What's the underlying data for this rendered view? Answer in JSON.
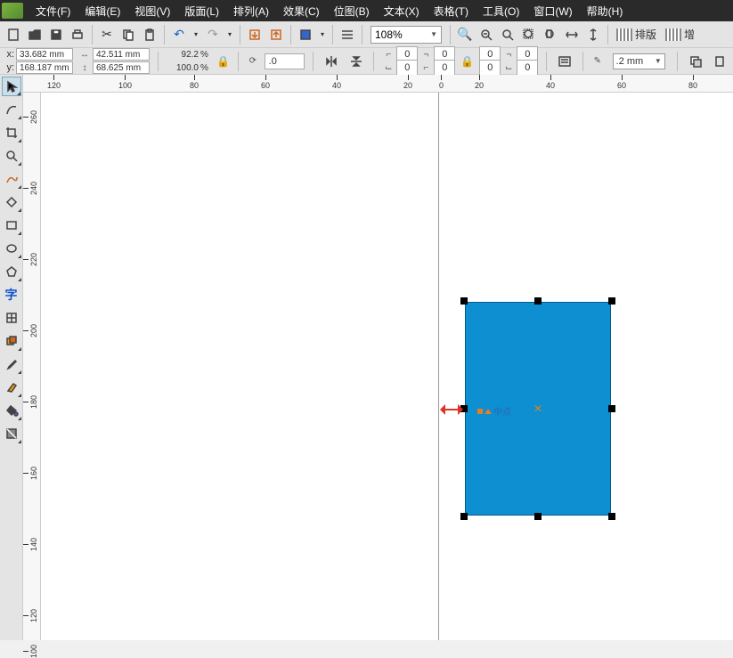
{
  "menu": {
    "file": "文件(F)",
    "edit": "编辑(E)",
    "view": "视图(V)",
    "layout": "版面(L)",
    "arrange": "排列(A)",
    "effects": "效果(C)",
    "bitmaps": "位图(B)",
    "text": "文本(X)",
    "table": "表格(T)",
    "tools": "工具(O)",
    "window": "窗口(W)",
    "help": "帮助(H)"
  },
  "toolbar": {
    "zoom": "108%",
    "layout_btn1": "排版",
    "layout_btn2": "增"
  },
  "props": {
    "x_label": "x:",
    "x_value": "33.682 mm",
    "y_label": "y:",
    "y_value": "168.187 mm",
    "w_value": "42.511 mm",
    "h_value": "68.625 mm",
    "sx": "92.2",
    "sy": "100.0",
    "pct": "%",
    "rotation": ".0",
    "spin": "0",
    "line_width": ".2 mm"
  },
  "ruler_h": [
    {
      "pos": 53,
      "val": "120"
    },
    {
      "pos": 133,
      "val": "100"
    },
    {
      "pos": 213,
      "val": "80"
    },
    {
      "pos": 293,
      "val": "60"
    },
    {
      "pos": 373,
      "val": "40"
    },
    {
      "pos": 453,
      "val": "20"
    },
    {
      "pos": 493,
      "val": "0"
    },
    {
      "pos": 533,
      "val": "20"
    },
    {
      "pos": 613,
      "val": "40"
    },
    {
      "pos": 693,
      "val": "60"
    },
    {
      "pos": 773,
      "val": "80"
    }
  ],
  "ruler_v": [
    {
      "pos": 20,
      "val": "260"
    },
    {
      "pos": 100,
      "val": "240"
    },
    {
      "pos": 180,
      "val": "220"
    },
    {
      "pos": 260,
      "val": "200"
    },
    {
      "pos": 340,
      "val": "180"
    },
    {
      "pos": 420,
      "val": "160"
    },
    {
      "pos": 500,
      "val": "140"
    },
    {
      "pos": 580,
      "val": "120"
    },
    {
      "pos": 620,
      "val": "100"
    }
  ],
  "snap_label": "中点",
  "colors": {
    "rect_fill": "#0d8fd1",
    "snap_arrow": "#d32f2f"
  }
}
